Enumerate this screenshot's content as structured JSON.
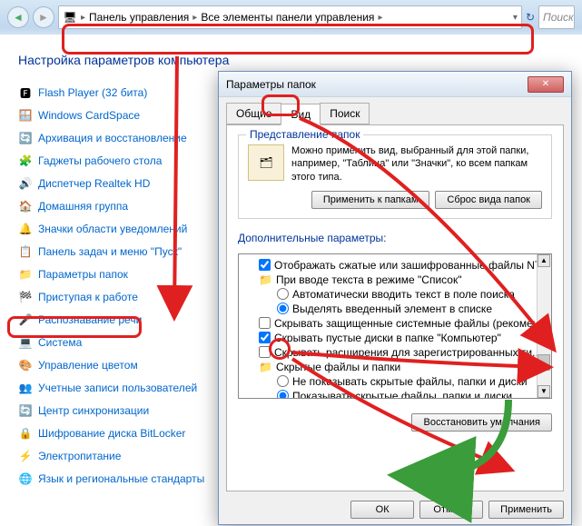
{
  "nav": {
    "breadcrumb1": "Панель управления",
    "breadcrumb2": "Все элементы панели управления",
    "search_placeholder": "Поиск"
  },
  "page_title": "Настройка параметров компьютера",
  "links": [
    {
      "icon": "🅵",
      "label": "Flash Player (32 бита)"
    },
    {
      "icon": "🪟",
      "label": "Windows CardSpace"
    },
    {
      "icon": "🔄",
      "label": "Архивация и восстановление"
    },
    {
      "icon": "🧩",
      "label": "Гаджеты рабочего стола"
    },
    {
      "icon": "🔊",
      "label": "Диспетчер Realtek HD"
    },
    {
      "icon": "🏠",
      "label": "Домашняя группа"
    },
    {
      "icon": "🔔",
      "label": "Значки области уведомлений"
    },
    {
      "icon": "📋",
      "label": "Панель задач и меню \"Пуск\""
    },
    {
      "icon": "📁",
      "label": "Параметры папок"
    },
    {
      "icon": "🏁",
      "label": "Приступая к работе"
    },
    {
      "icon": "🎤",
      "label": "Распознавание речи"
    },
    {
      "icon": "💻",
      "label": "Система"
    },
    {
      "icon": "🎨",
      "label": "Управление цветом"
    },
    {
      "icon": "👥",
      "label": "Учетные записи пользователей"
    },
    {
      "icon": "🔄",
      "label": "Центр синхронизации"
    },
    {
      "icon": "🔒",
      "label": "Шифрование диска BitLocker"
    },
    {
      "icon": "⚡",
      "label": "Электропитание"
    },
    {
      "icon": "🌐",
      "label": "Язык и региональные стандарты"
    }
  ],
  "dialog": {
    "title": "Параметры папок",
    "tabs": [
      "Общие",
      "Вид",
      "Поиск"
    ],
    "view_group_title": "Представление папок",
    "view_text": "Можно применить вид, выбранный для этой папки, например, \"Таблица\" или \"Значки\", ко всем папкам этого типа.",
    "apply_to_folders": "Применить к папкам",
    "reset_folders": "Сброс вида папок",
    "adv_label": "Дополнительные параметры:",
    "tree": [
      {
        "type": "checkbox",
        "checked": true,
        "level": 1,
        "label": "Отображать сжатые или зашифрованные файлы NTFS"
      },
      {
        "type": "folder",
        "level": 1,
        "label": "При вводе текста в режиме \"Список\""
      },
      {
        "type": "radio",
        "checked": false,
        "level": 2,
        "label": "Автоматически вводить текст в поле поиска"
      },
      {
        "type": "radio",
        "checked": true,
        "level": 2,
        "label": "Выделять введенный элемент в списке"
      },
      {
        "type": "checkbox",
        "checked": false,
        "level": 1,
        "label": "Скрывать защищенные системные файлы (рекомен..."
      },
      {
        "type": "checkbox",
        "checked": true,
        "level": 1,
        "label": "Скрывать пустые диски в папке \"Компьютер\""
      },
      {
        "type": "checkbox",
        "checked": false,
        "level": 1,
        "label": "Скрывать расширения для зарегистрированных ти..."
      },
      {
        "type": "folder",
        "level": 1,
        "label": "Скрытые файлы и папки"
      },
      {
        "type": "radio",
        "checked": false,
        "level": 2,
        "label": "Не показывать скрытые файлы, папки и диски"
      },
      {
        "type": "radio",
        "checked": true,
        "level": 2,
        "label": "Показывать скрытые файлы, папки и диски"
      }
    ],
    "restore_defaults": "Восстановить умолчания",
    "ok": "ОК",
    "cancel": "Отмена",
    "apply": "Применить"
  }
}
